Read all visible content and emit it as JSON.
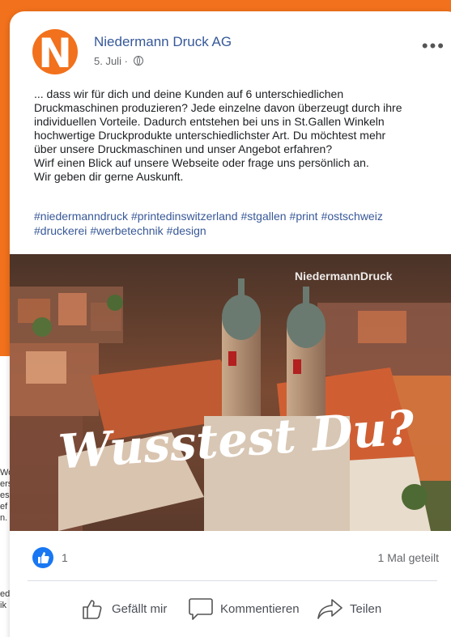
{
  "post": {
    "page_name": "Niedermann Druck AG",
    "date": "5. Juli",
    "meta_separator": " · ",
    "logo_letter": "N",
    "more_label": "•••",
    "body_lines": [
      "... dass wir für dich und deine Kunden auf 6 unterschiedlichen",
      "Druckmaschinen produzieren? Jede einzelne davon überzeugt durch ihre",
      "individuellen Vorteile. Dadurch entstehen bei uns in St.Gallen Winkeln",
      "hochwertige Druckprodukte unterschiedlichster Art. Du möchtest mehr",
      "über unsere Druckmaschinen und unser Angebot erfahren?",
      "Wirf einen Blick auf unsere Webseite oder frage uns persönlich an.",
      "Wir geben dir gerne Auskunft."
    ],
    "hashtags": [
      "#niedermanndruck",
      "#printedinswitzerland",
      "#stgallen",
      "#print",
      "#ostschweiz",
      "#druckerei",
      "#werbetechnik",
      "#design"
    ],
    "image": {
      "overlay_title": "Wusstest Du?",
      "watermark": "NiedermannDruck"
    },
    "reactions": {
      "like_count": "1",
      "share_count": "1 Mal geteilt"
    },
    "actions": {
      "like": "Gefällt mir",
      "comment": "Kommentieren",
      "share": "Teilen"
    }
  },
  "background_fragments": [
    "Wo",
    "ers",
    "es",
    "ef",
    "n.",
    "ed",
    "ik"
  ],
  "colors": {
    "brand_orange": "#f2711c",
    "link_blue": "#365899",
    "like_blue": "#1877f2"
  }
}
